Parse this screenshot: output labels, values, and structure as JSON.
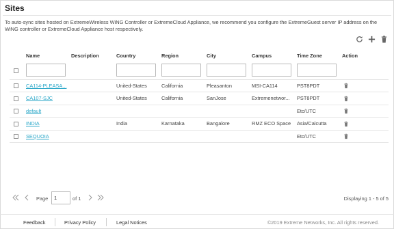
{
  "page": {
    "title": "Sites",
    "info": "To auto-sync sites hosted on ExtremeWireless WiNG Controller or ExtremeCloud Appliance, we recommend you configure the ExtremeGuest server IP address on the WiNG controller or ExtremeCloud Appliance host respectively."
  },
  "toolbar": {
    "refresh_icon": "refresh-icon",
    "add_icon": "plus-icon",
    "delete_icon": "trash-icon"
  },
  "table": {
    "headers": {
      "name": "Name",
      "description": "Description",
      "country": "Country",
      "region": "Region",
      "city": "City",
      "campus": "Campus",
      "timezone": "Time Zone",
      "action": "Action"
    },
    "filters": {
      "name": "",
      "country": "",
      "region": "",
      "city": "",
      "campus": "",
      "timezone": ""
    },
    "rows": [
      {
        "name": "CA114-PLEASA...",
        "description": "",
        "country": "United-States",
        "region": "California",
        "city": "Pleasanton",
        "campus": "MSI-CA114",
        "timezone": "PST8PDT"
      },
      {
        "name": "CA107-SJC",
        "description": "",
        "country": "United-States",
        "region": "California",
        "city": "SanJose",
        "campus": "Extremenetwor...",
        "timezone": "PST8PDT"
      },
      {
        "name": "default",
        "description": "",
        "country": "",
        "region": "",
        "city": "",
        "campus": "",
        "timezone": "Etc/UTC"
      },
      {
        "name": "INDIA",
        "description": "",
        "country": "India",
        "region": "Karnataka",
        "city": "Bangalore",
        "campus": "RMZ ECO Space",
        "timezone": "Asia/Calcutta"
      },
      {
        "name": "SEQUOIA",
        "description": "",
        "country": "",
        "region": "",
        "city": "",
        "campus": "",
        "timezone": "Etc/UTC"
      }
    ]
  },
  "pager": {
    "page_label": "Page",
    "current_page": "1",
    "of_label": "of 1",
    "displaying": "Displaying 1 - 5 of 5"
  },
  "footer": {
    "feedback": "Feedback",
    "privacy": "Privacy Policy",
    "legal": "Legal Notices",
    "copyright": "©2019 Extreme Networks, Inc. All rights reserved."
  },
  "colors": {
    "link": "#2aa7c8",
    "border": "#e3e3e3"
  }
}
